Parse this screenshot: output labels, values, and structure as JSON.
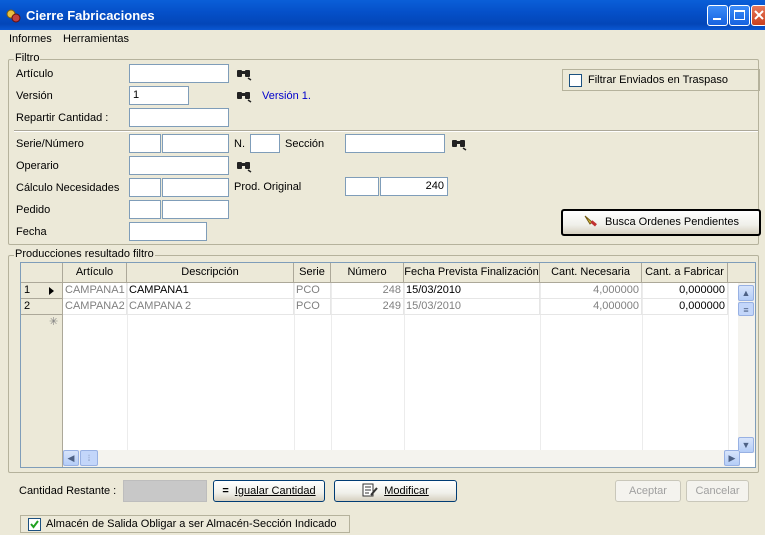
{
  "window": {
    "title": "Cierre Fabricaciones"
  },
  "menu": [
    "Informes",
    "Herramientas"
  ],
  "filter": {
    "group_label": "Filtro",
    "articulo_label": "Artículo",
    "articulo_value": "",
    "version_label": "Versión",
    "version_value": "1",
    "version_link": "Versión 1.",
    "repartir_label": "Repartir Cantidad :",
    "repartir_value": "",
    "traspaso_label": "Filtrar Enviados en Traspaso",
    "serie_label": "Serie/Número",
    "n_label": "N.",
    "seccion_label": "Sección",
    "operario_label": "Operario",
    "calculo_label": "Cálculo Necesidades",
    "prod_original_label": "Prod. Original",
    "prod_original_value": "240",
    "pedido_label": "Pedido",
    "fecha_label": "Fecha",
    "busca_button": "Busca Ordenes Pendientes"
  },
  "results": {
    "group_label": "Producciones resultado filtro",
    "columns": [
      "Artículo",
      "Descripción",
      "Serie",
      "Número",
      "Fecha Prevista Finalización",
      "Cant. Necesaria",
      "Cant. a Fabricar"
    ],
    "rows": [
      {
        "n": "1",
        "articulo": "CAMPANA1",
        "descripcion": "CAMPANA1",
        "serie": "PCO",
        "numero": "248",
        "fecha": "15/03/2010",
        "cant_nec": "4,000000",
        "cant_fab": "0,000000"
      },
      {
        "n": "2",
        "articulo": "CAMPANA2",
        "descripcion": "CAMPANA 2",
        "serie": "PCO",
        "numero": "249",
        "fecha": "15/03/2010",
        "cant_nec": "4,000000",
        "cant_fab": "0,000000"
      }
    ]
  },
  "footer": {
    "cantidad_restante_label": "Cantidad Restante :",
    "igualar_button": "Igualar Cantidad",
    "modificar_button": "Modificar",
    "aceptar_button": "Aceptar",
    "cancelar_button": "Cancelar",
    "almacen_checkbox": "Almacén de Salida Obligar a ser Almacén-Sección Indicado",
    "almacen_checked": true
  }
}
